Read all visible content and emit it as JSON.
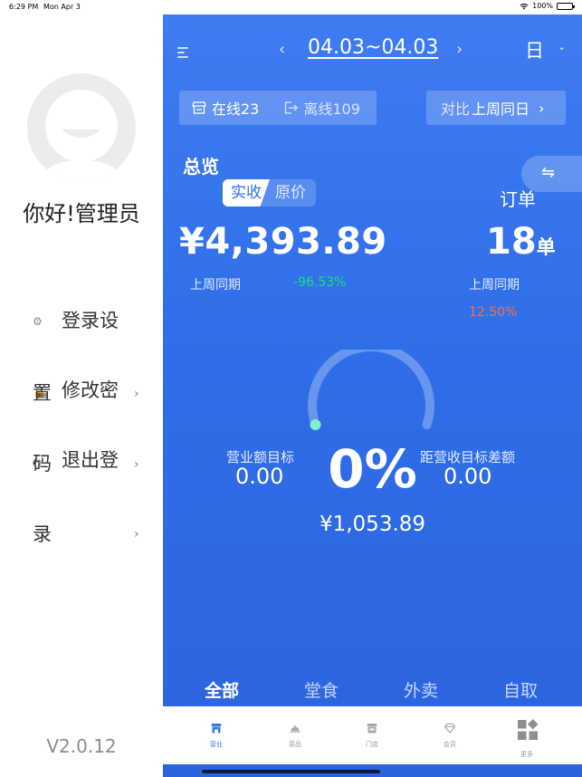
{
  "status_bar": {
    "time": "6:29 PM",
    "date": "Mon Apr 3",
    "battery": "100%"
  },
  "drawer": {
    "greeting": "你好!管理员",
    "menu_lines": [
      "登录设",
      "置",
      "修改密",
      "码",
      "退出登",
      "录"
    ],
    "version": "V2.0.12"
  },
  "header": {
    "date_range": "04.03~04.03",
    "period": "日",
    "prev_icon": "chevron-left-icon",
    "next_icon": "chevron-right-icon"
  },
  "store_status": {
    "online_label": "在线23",
    "offline_label": "离线109"
  },
  "compare": {
    "prefix": "对比",
    "target": "上周同日"
  },
  "overview": {
    "title": "总览",
    "toggle_active": "实收",
    "toggle_inactive": "原价",
    "revenue": "¥4,393.89",
    "revenue_compare_label": "上周同期",
    "revenue_change": "-96.53%",
    "orders_title": "订单",
    "orders_count": "18",
    "orders_unit": "单",
    "orders_compare_label": "上周同期",
    "orders_change": "12.50%"
  },
  "goal": {
    "percent": "0%",
    "progress": 0,
    "target_label": "营业额目标",
    "target_value": "0.00",
    "gap_label": "距营收目标差额",
    "gap_value": "0.00",
    "goal_amount": "¥1,053.89"
  },
  "channel_tabs": [
    "全部",
    "堂食",
    "外卖",
    "自取"
  ],
  "bottom_nav": [
    {
      "label": "营业",
      "icon": "store-icon"
    },
    {
      "label": "菜品",
      "icon": "dish-cloche-icon"
    },
    {
      "label": "门店",
      "icon": "shop-icon"
    },
    {
      "label": "会员",
      "icon": "diamond-icon"
    },
    {
      "label": "更多",
      "icon": "grid-more-icon"
    }
  ],
  "colors": {
    "accent": "#2f6ee8",
    "positive": "#18e07a",
    "negative": "#ff6a4a",
    "gauge_dot": "#7ff0c8"
  }
}
